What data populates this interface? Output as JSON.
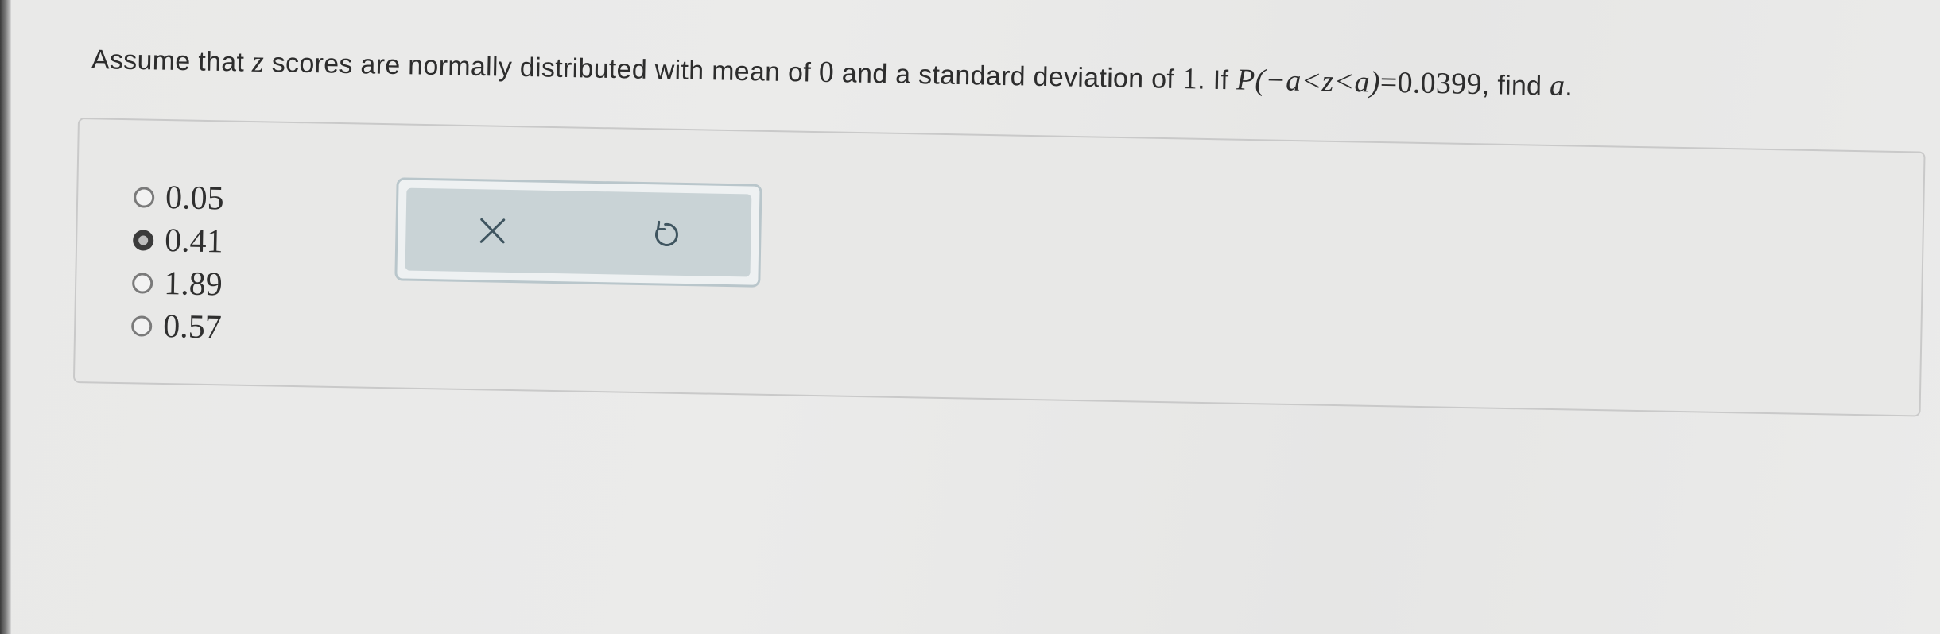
{
  "question": {
    "part1": "Assume that ",
    "var_z": "z",
    "part2": " scores are normally distributed with mean of ",
    "mean": "0",
    "part3": " and a standard deviation of ",
    "sd": "1",
    "part4": ". If ",
    "prob_expr": "P(−a<z<a)",
    "equals": "=0.0399",
    "part5": ", find ",
    "var_a": "a",
    "part6": "."
  },
  "options": [
    {
      "label": "0.05",
      "selected": false
    },
    {
      "label": "0.41",
      "selected": true
    },
    {
      "label": "1.89",
      "selected": false
    },
    {
      "label": "0.57",
      "selected": false
    }
  ],
  "actions": {
    "clear_icon": "close-icon",
    "reset_icon": "undo-icon"
  },
  "colors": {
    "action_box_border": "#b9c6cb",
    "action_box_fill": "#c9d3d6",
    "radio_selected": "#3b3b3b"
  }
}
